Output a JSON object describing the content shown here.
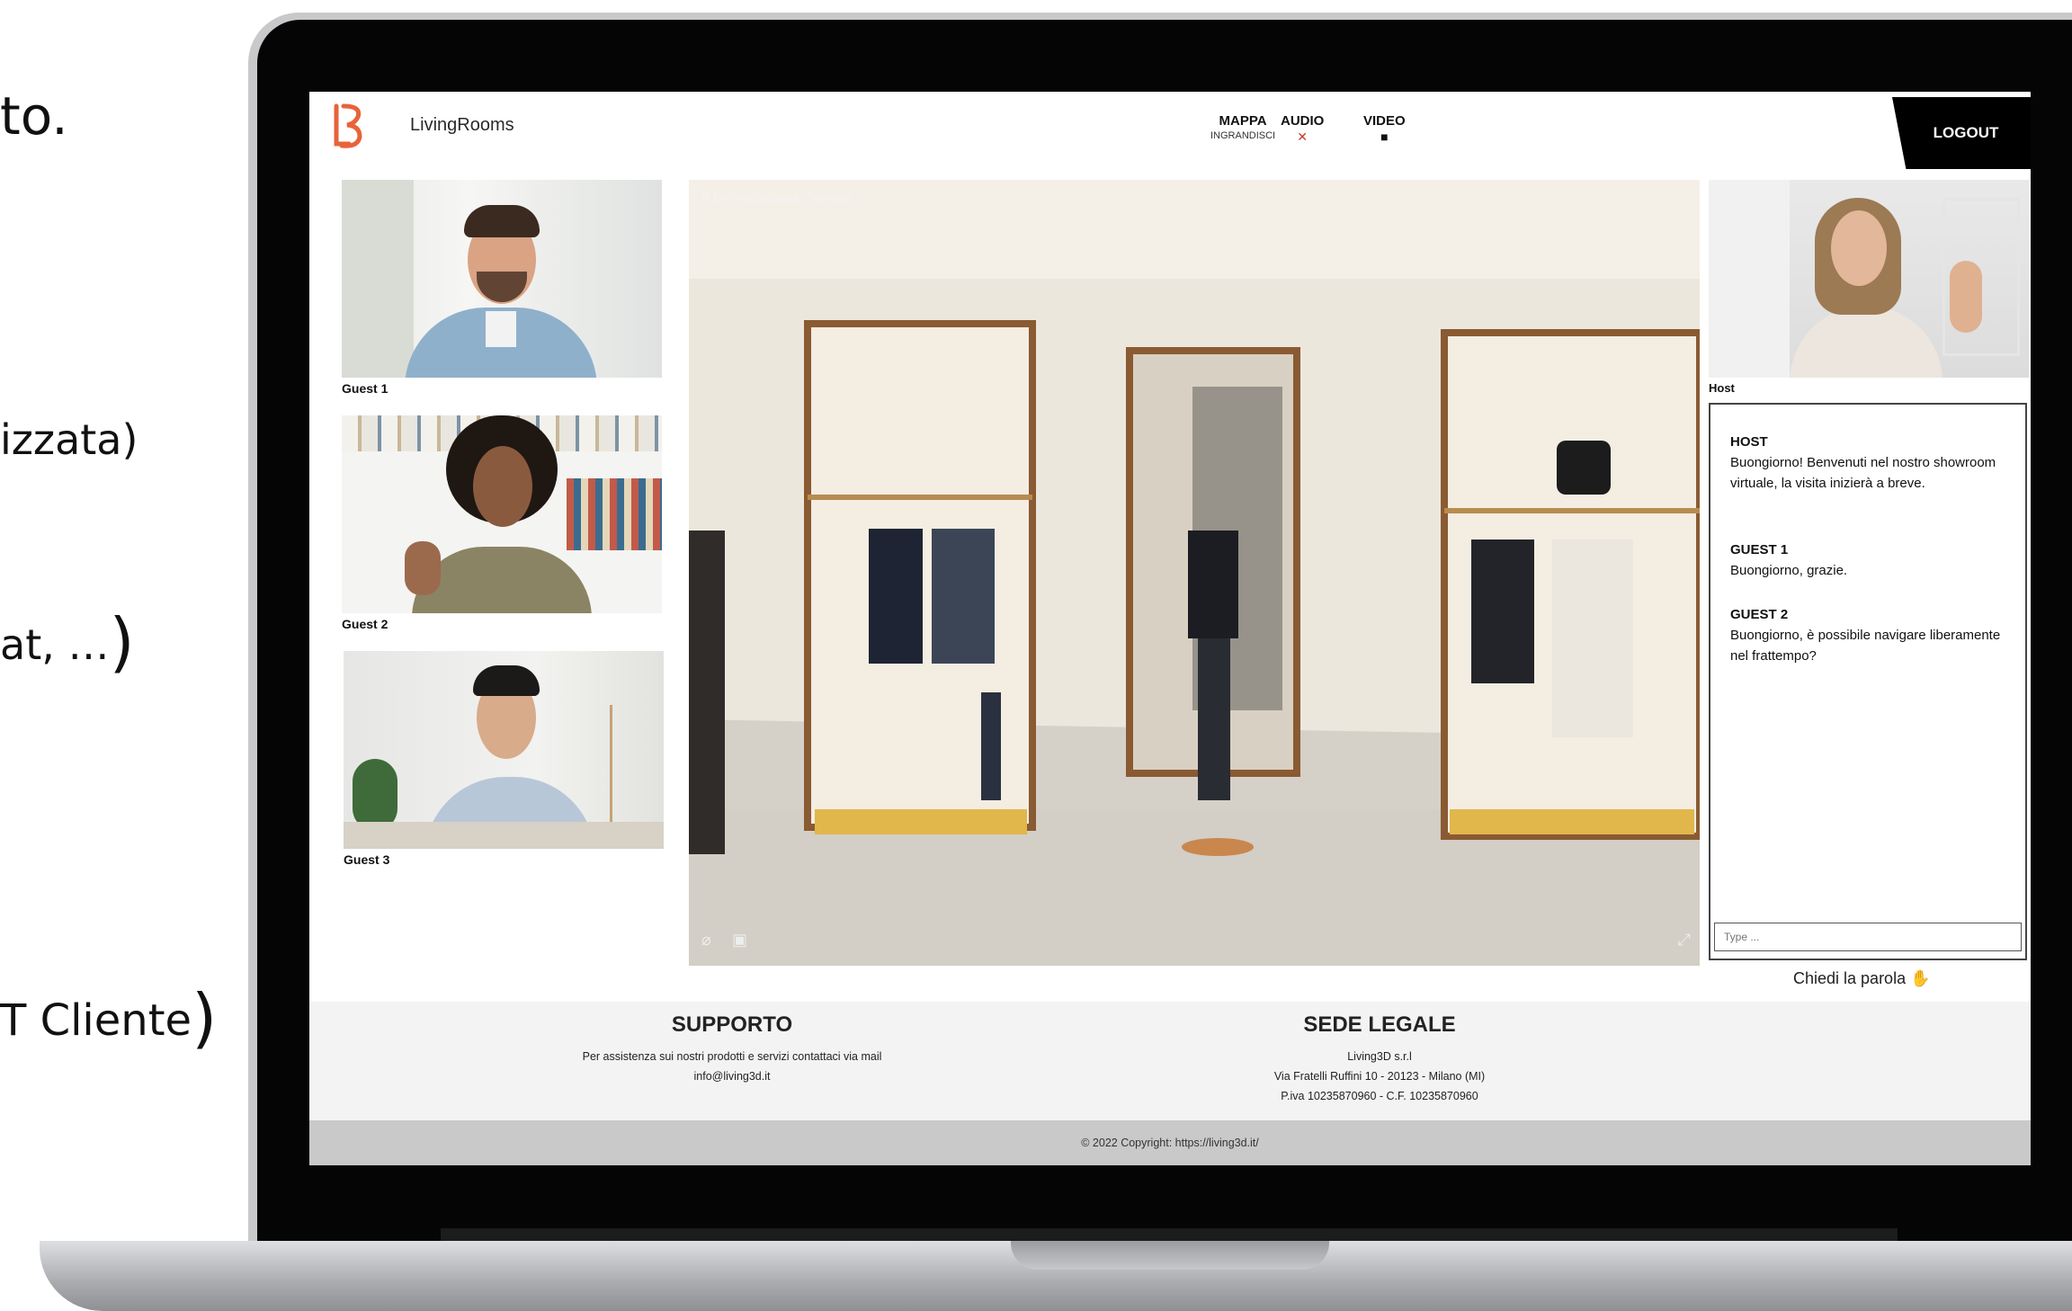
{
  "slide": {
    "line1": "to.",
    "line2": "izzata)",
    "line3": "at, …",
    "line4": "T Cliente"
  },
  "app": {
    "brand": "LivingRooms"
  },
  "nav": {
    "map_label": "MAPPA",
    "map_sub": "INGRANDISCI",
    "audio_label": "AUDIO",
    "video_label": "VIDEO",
    "logout_label": "LOGOUT"
  },
  "guests": [
    {
      "label": "Guest 1"
    },
    {
      "label": "Guest 2"
    },
    {
      "label": "Guest 3"
    }
  ],
  "tour": {
    "location": "Dolce&Gabbana - Venezia"
  },
  "host": {
    "label": "Host"
  },
  "chat": {
    "messages": [
      {
        "author": "HOST",
        "text": "Buongiorno! Benvenuti nel nostro showroom virtuale, la visita inizierà a breve."
      },
      {
        "author": "GUEST 1",
        "text": "Buongiorno, grazie."
      },
      {
        "author": "GUEST 2",
        "text": "Buongiorno, è possibile navigare liberamente nel frattempo?"
      }
    ],
    "input_placeholder": "Type ...",
    "raise_hand_label": "Chiedi la parola"
  },
  "footer": {
    "support": {
      "title": "SUPPORTO",
      "line1": "Per assistenza sui nostri prodotti e servizi contattaci via mail",
      "line2": "info@living3d.it"
    },
    "legal": {
      "title": "SEDE LEGALE",
      "line1": "Living3D s.r.l",
      "line2": "Via Fratelli Ruffini 10 - 20123 - Milano (MI)",
      "line3": "P.iva 10235870960 - C.F. 10235870960"
    },
    "copyright": "© 2022 Copyright: https://living3d.it/"
  },
  "colors": {
    "logo": "#e8633a",
    "logout_bg": "#000000",
    "footer_bg": "#f3f3f3",
    "copyright_bg": "#c9c9c9"
  }
}
